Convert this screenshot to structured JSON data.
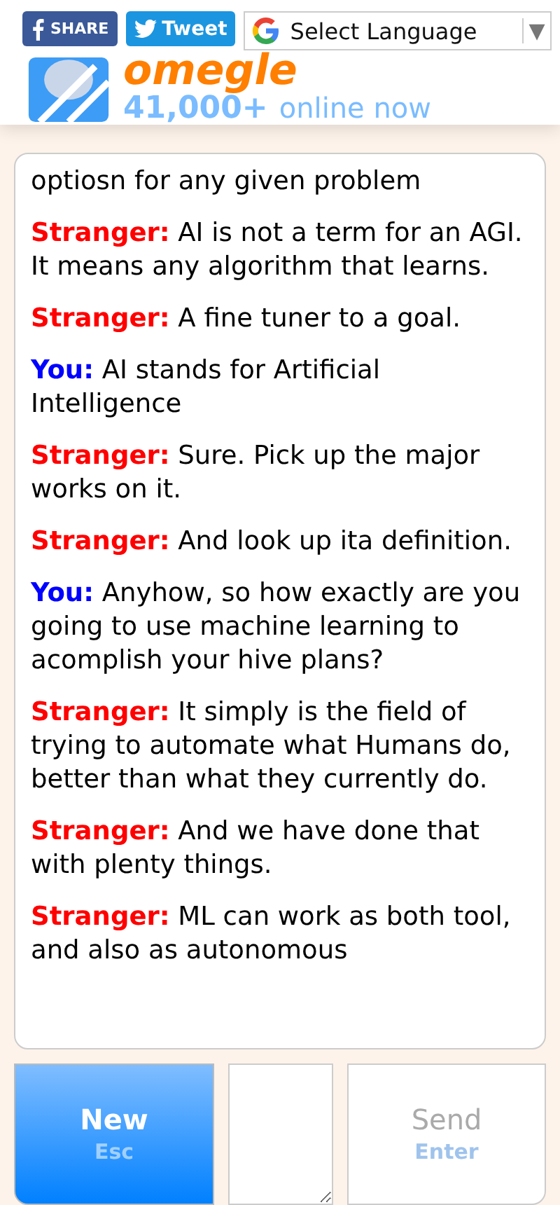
{
  "header": {
    "share_buttons": [
      {
        "kind": "facebook",
        "label": "SHARE"
      },
      {
        "kind": "twitter",
        "label": "Tweet"
      }
    ],
    "language_select": {
      "label": "Select Language",
      "arrow": "▼"
    },
    "logo": "omegle",
    "online_count": "41,000+",
    "online_label": "online now"
  },
  "messages": [
    {
      "kind": "continued",
      "text": "optiosn for any given problem"
    },
    {
      "kind": "stranger",
      "speaker": "Stranger:",
      "text": "AI is not a term for an AGI. It means any algorithm that learns."
    },
    {
      "kind": "stranger",
      "speaker": "Stranger:",
      "text": "A fine tuner to a goal."
    },
    {
      "kind": "you",
      "speaker": "You:",
      "text": "AI stands for Artificial Intelligence"
    },
    {
      "kind": "stranger",
      "speaker": "Stranger:",
      "text": "Sure. Pick up the major works on it."
    },
    {
      "kind": "stranger",
      "speaker": "Stranger:",
      "text": "And look up ita definition."
    },
    {
      "kind": "you",
      "speaker": "You:",
      "text": "Anyhow, so how exactly are you going to use machine learning to acomplish your hive plans?"
    },
    {
      "kind": "stranger",
      "speaker": "Stranger:",
      "text": "It simply is the field of trying to automate what Humans do, better than what they currently do."
    },
    {
      "kind": "stranger",
      "speaker": "Stranger:",
      "text": "And we have done that with plenty things."
    },
    {
      "kind": "stranger",
      "speaker": "Stranger:",
      "text": "ML can work as both tool, and also as autonomous"
    }
  ],
  "controls": {
    "new_button": {
      "label": "New",
      "key": "Esc"
    },
    "send_button": {
      "label": "Send",
      "key": "Enter",
      "disabled": true
    }
  }
}
